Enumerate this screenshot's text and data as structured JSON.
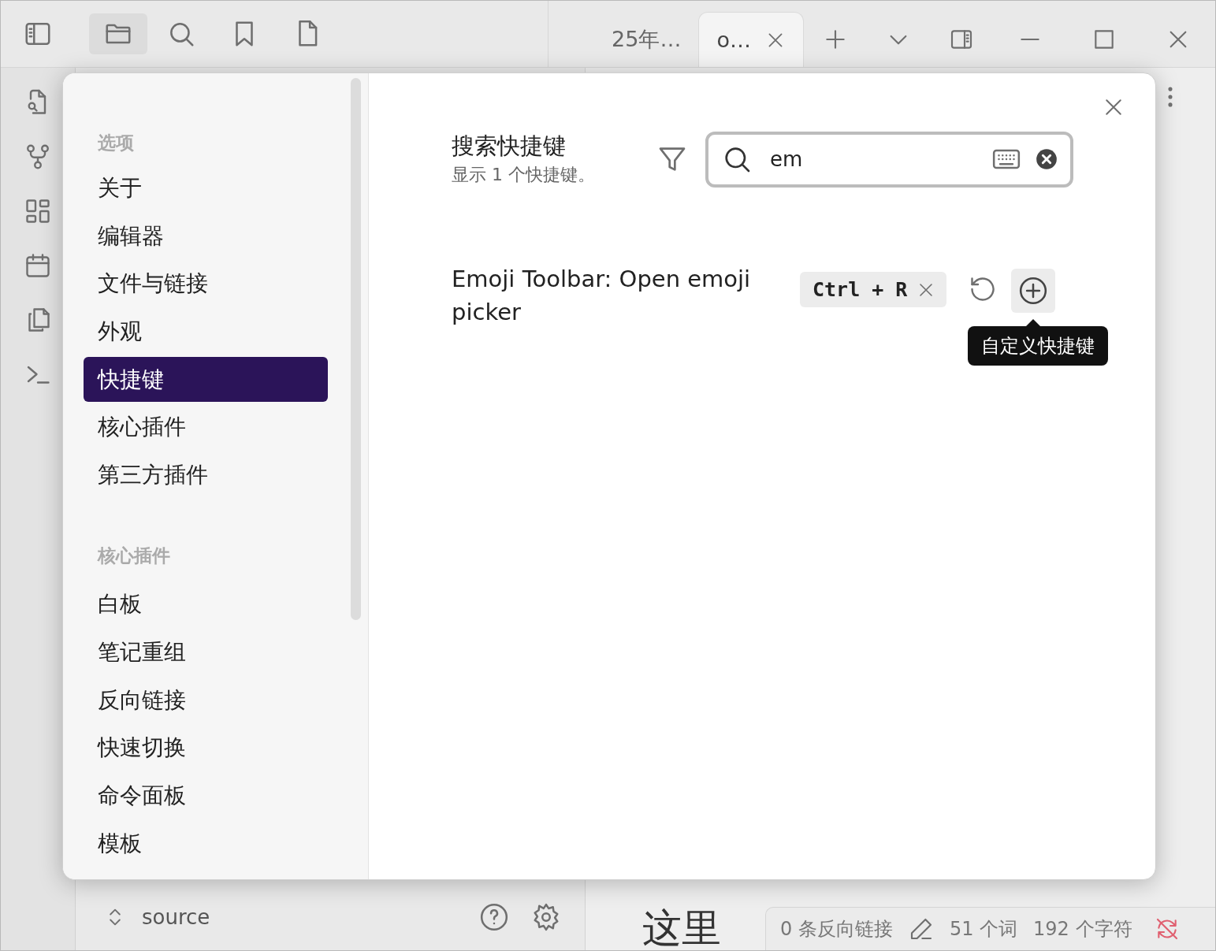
{
  "tabs": [
    {
      "label": "25年…",
      "selected": false
    },
    {
      "label": "o…",
      "selected": true
    }
  ],
  "file_explorer": {
    "vault": "source"
  },
  "editor": {
    "heading": "这里"
  },
  "status_bar": {
    "backlinks": "0 条反向链接",
    "words": "51 个词",
    "characters": "192 个字符"
  },
  "settings": {
    "sidebar": [
      {
        "heading": "选项",
        "items": [
          {
            "label": "关于",
            "selected": false
          },
          {
            "label": "编辑器",
            "selected": false
          },
          {
            "label": "文件与链接",
            "selected": false
          },
          {
            "label": "外观",
            "selected": false
          },
          {
            "label": "快捷键",
            "selected": true
          },
          {
            "label": "核心插件",
            "selected": false
          },
          {
            "label": "第三方插件",
            "selected": false
          }
        ]
      },
      {
        "heading": "核心插件",
        "items": [
          {
            "label": "白板",
            "selected": false
          },
          {
            "label": "笔记重组",
            "selected": false
          },
          {
            "label": "反向链接",
            "selected": false
          },
          {
            "label": "快速切换",
            "selected": false
          },
          {
            "label": "命令面板",
            "selected": false
          },
          {
            "label": "模板",
            "selected": false
          }
        ]
      }
    ],
    "title": "搜索快捷键",
    "subtitle": "显示 1 个快捷键。",
    "search": {
      "value": "em"
    },
    "hotkeys": [
      {
        "command": "Emoji Toolbar: Open emoji picker",
        "keys": [
          "Ctrl + R"
        ]
      }
    ],
    "tooltip": "自定义快捷键"
  }
}
